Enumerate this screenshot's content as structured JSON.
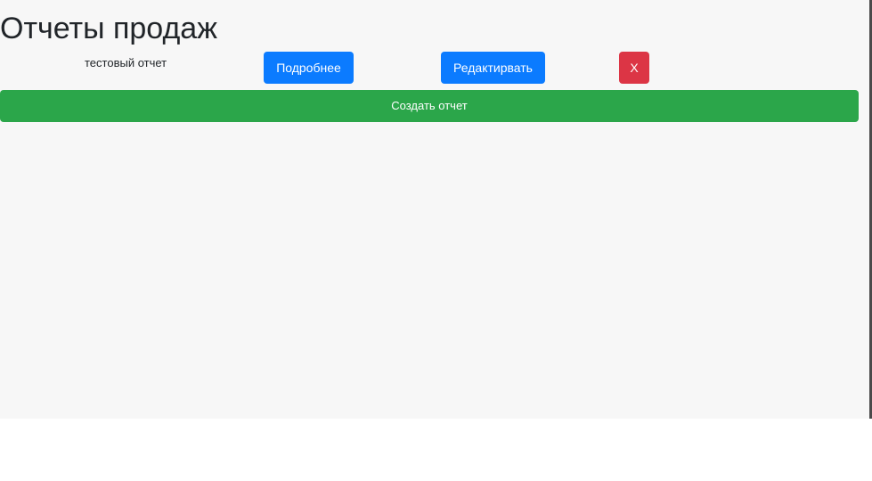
{
  "page": {
    "title": "Отчеты продаж"
  },
  "reports": [
    {
      "name": "тестовый отчет",
      "details_label": "Подробнее",
      "edit_label": "Редактирвать",
      "delete_label": "X"
    }
  ],
  "actions": {
    "create_label": "Создать отчет"
  },
  "colors": {
    "background": "#f7f7f7",
    "primary": "#0b7bff",
    "danger": "#dc3545",
    "success": "#2ba64a",
    "text": "#212529"
  }
}
